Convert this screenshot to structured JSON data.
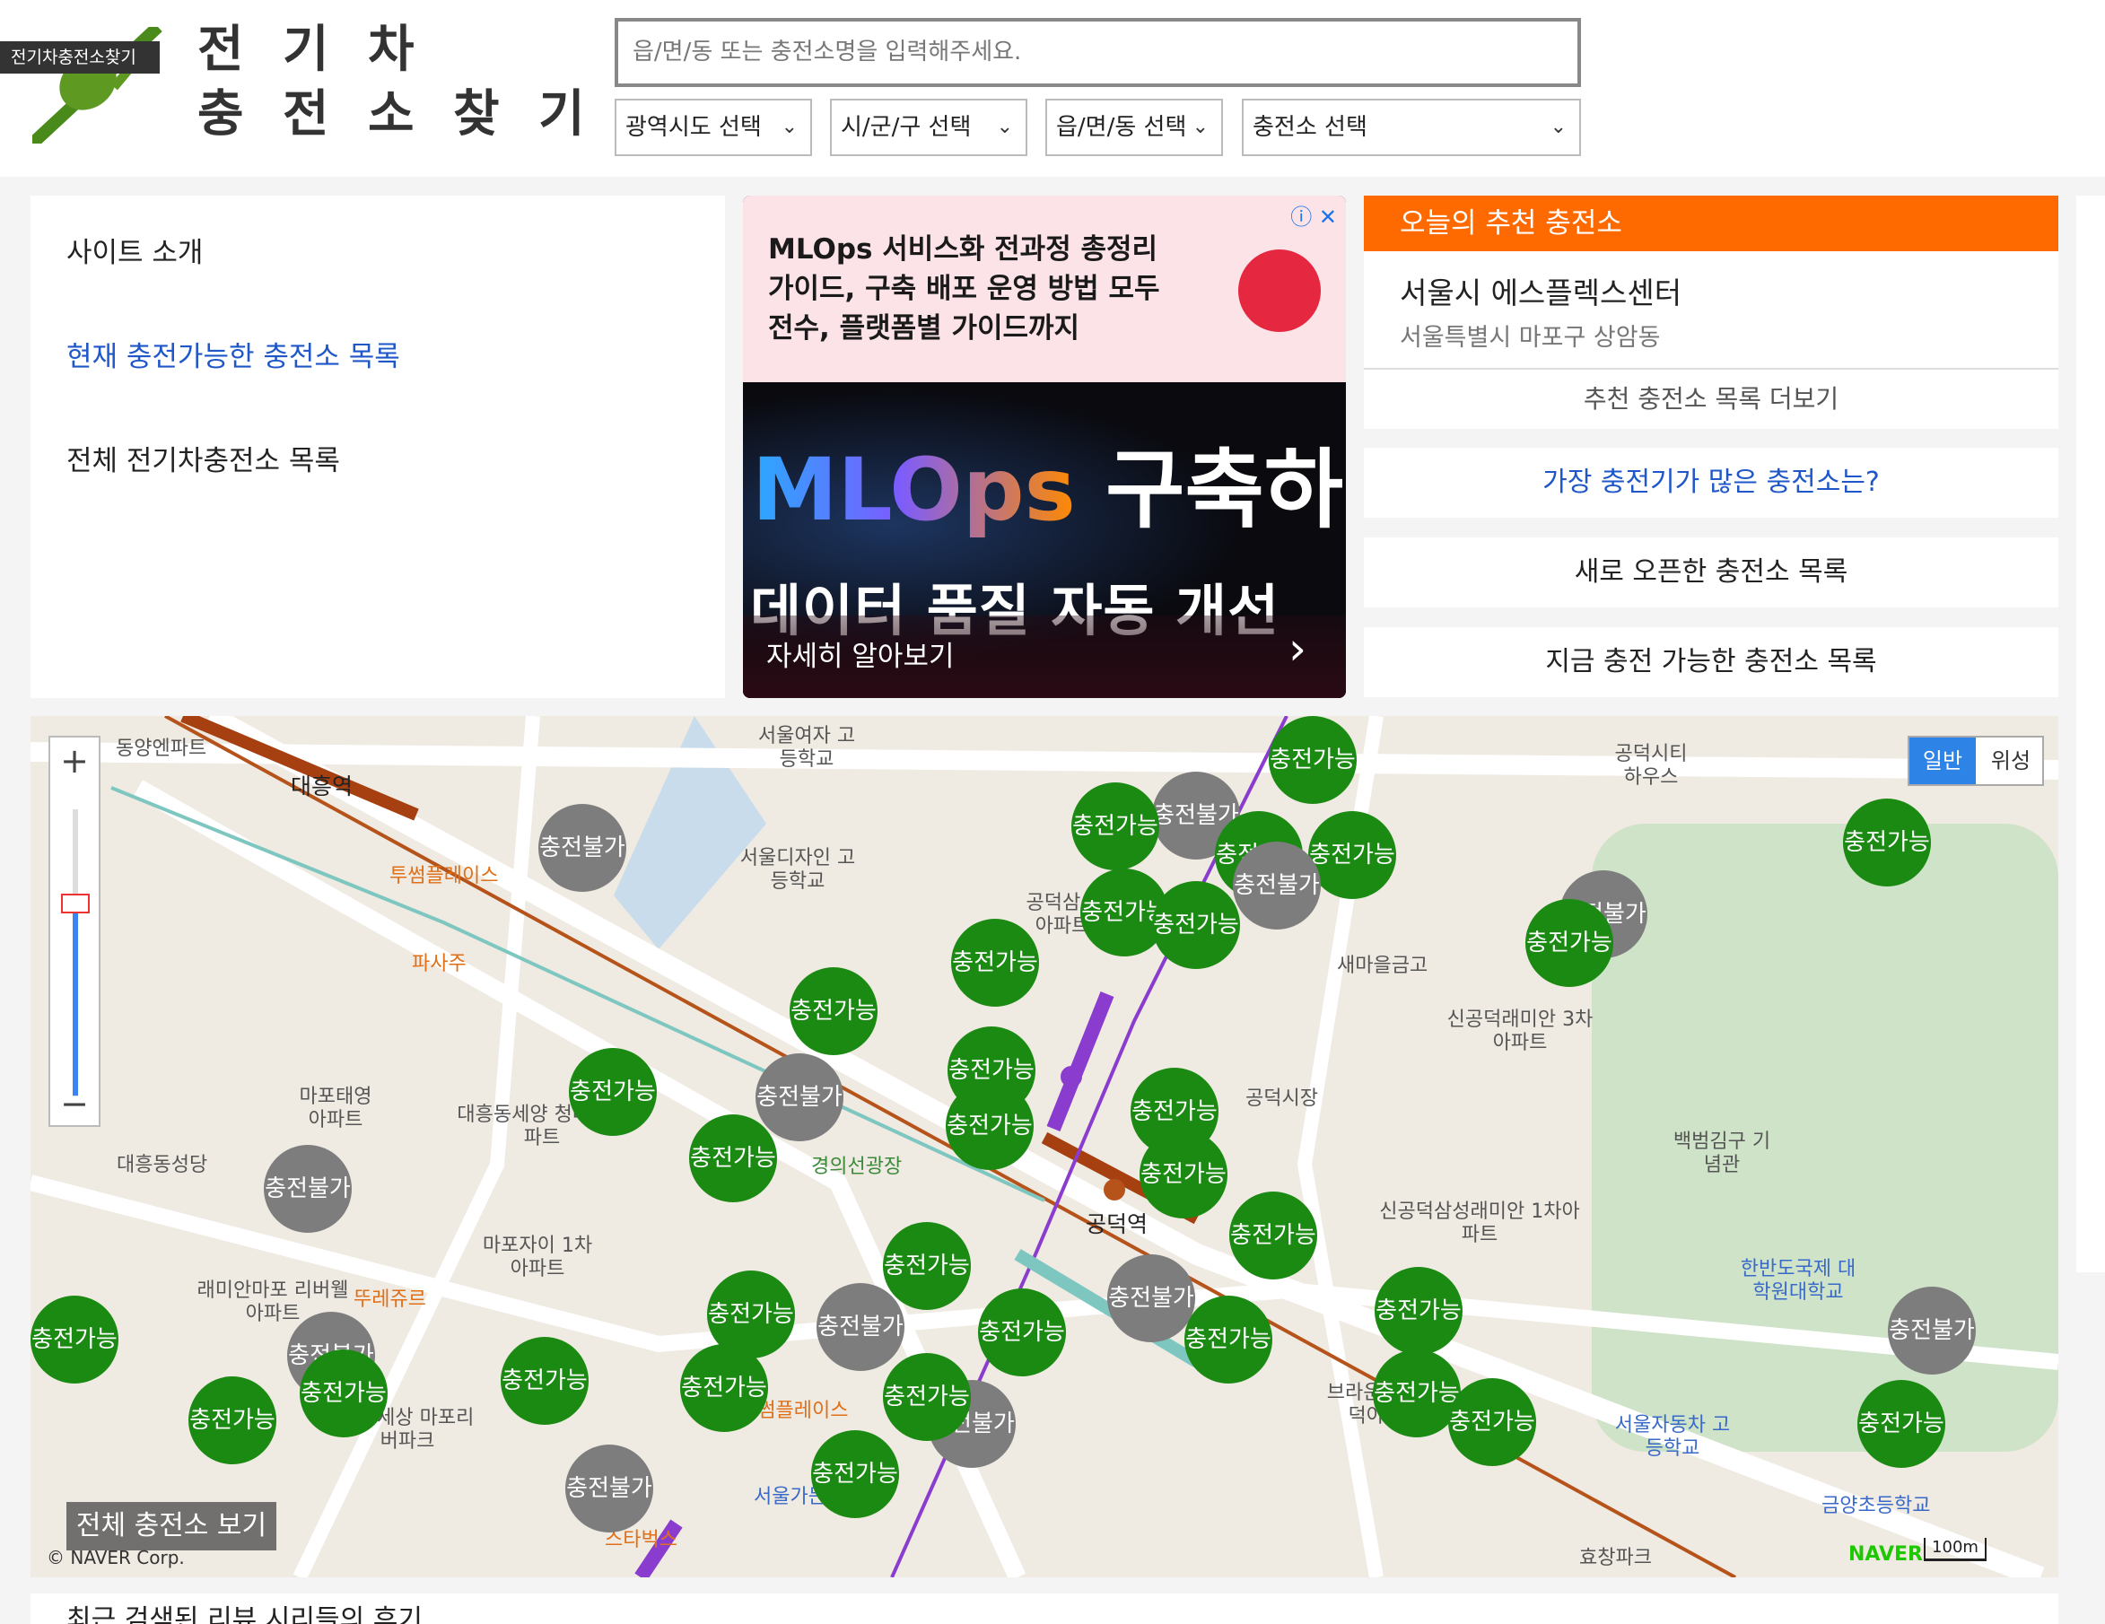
{
  "header": {
    "tag": "전기차충전소찾기",
    "title_line1": "전 기 차",
    "title_line2": "충 전 소 찾 기",
    "search_placeholder": "읍/면/동 또는 충전소명을 입력해주세요.",
    "selects": [
      "광역시도 선택",
      "시/군/구 선택",
      "읍/면/동 선택",
      "충전소 선택"
    ]
  },
  "leftnav": {
    "items": [
      "사이트 소개",
      "현재 충전가능한 충전소 목록",
      "전체 전기차충전소 목록"
    ]
  },
  "ad": {
    "text": "MLOps 서비스화 전과정 총정리 가이드, 구축 배포 운영 방법 모두 전수, 플랫폼별 가이드까지",
    "big_mlops": "MLOps",
    "big_rest": " 구축하고",
    "sub": "데이터 품질 자동 개선",
    "cta": "자세히 알아보기"
  },
  "recommend": {
    "heading": "오늘의 추천 충전소",
    "name": "서울시 에스플렉스센터",
    "address": "서울특별시 마포구 상암동",
    "more": "추천 충전소 목록 더보기",
    "links": [
      "가장 충전기가 많은 충전소는?",
      "새로 오픈한 충전소 목록",
      "지금 충전 가능한 충전소 목록"
    ]
  },
  "map": {
    "maptype": [
      "일반",
      "위성"
    ],
    "all_button": "전체 충전소 보기",
    "copyright": "© NAVER Corp.",
    "naver": "NAVER",
    "scale": "100m",
    "available": "충전가능",
    "unavailable": "충전불가",
    "labels": [
      "동양엔파트",
      "대흥역",
      "투썸플레이스",
      "파사주",
      "서울여자 고등학교",
      "서울디자인 고등학교",
      "공덕삼성 아파트",
      "새마을금고",
      "신공덕래미안 3차아파트",
      "공덕시티 하우스",
      "마포태영 아파트",
      "대흥동세양 청마루아파트",
      "대흥동성당",
      "경의선광장",
      "공덕역",
      "공덕시장",
      "백범김구 기념관",
      "신공덕삼성래미안 1차아파트",
      "마포자이 1차아파트",
      "래미안마포 리버웰아파트",
      "뚜레쥬르",
      "한반도국제 대학원대학교",
      "브라운스톤 공덕아파트",
      "서울자동차 고등학교",
      "투썸플레이스",
      "서울가든호텔",
      "스타벅스",
      "효창파크",
      "금양초등학교",
      "신한세상 마포리버파크"
    ]
  },
  "bottom": {
    "title": "최근 검색된 리뷰 시리들의 후기"
  }
}
